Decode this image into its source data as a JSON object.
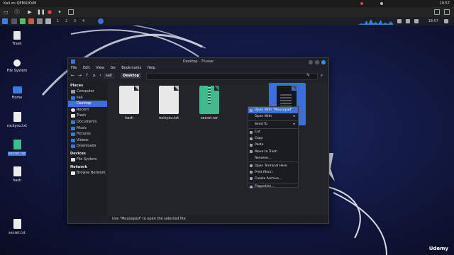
{
  "host": {
    "window_title": "Kali on QEMU/KVM",
    "clock": "19:57"
  },
  "panel": {
    "workspaces": [
      "1",
      "2",
      "3",
      "4"
    ],
    "clock": "18:57"
  },
  "desktop_icons": [
    {
      "label": "Trash",
      "icon": "trash-icon"
    },
    {
      "label": "File System",
      "icon": "drive-icon"
    },
    {
      "label": "Home",
      "icon": "home-folder-icon"
    },
    {
      "label": "rockyou.txt",
      "icon": "text-file-icon"
    },
    {
      "label": "secret.rar",
      "icon": "archive-file-icon"
    },
    {
      "label": "hash",
      "icon": "text-file-icon"
    },
    {
      "label": "secret.txt",
      "icon": "text-file-icon"
    }
  ],
  "window": {
    "title": "Desktop - Thunar",
    "menu": [
      "File",
      "Edit",
      "View",
      "Go",
      "Bookmarks",
      "Help"
    ],
    "breadcrumbs": [
      "kali",
      "Desktop"
    ]
  },
  "sidebar": {
    "places_label": "Places",
    "places": [
      "Computer",
      "kali",
      "Desktop",
      "Recent",
      "Trash",
      "Documents",
      "Music",
      "Pictures",
      "Videos",
      "Downloads"
    ],
    "devices_label": "Devices",
    "devices": [
      "File System"
    ],
    "network_label": "Network",
    "network": [
      "Browse Network"
    ]
  },
  "files": [
    {
      "name": "hash",
      "type": "text"
    },
    {
      "name": "rockyou.txt",
      "type": "text"
    },
    {
      "name": "secret.rar",
      "type": "archive"
    },
    {
      "name": "sec",
      "type": "text",
      "selected": true
    }
  ],
  "context_menu": [
    {
      "label": "Open With \"Mousepad\"",
      "highlighted": true
    },
    {
      "label": "Open With",
      "submenu": true
    },
    {
      "label": "Send To",
      "submenu": true
    },
    {
      "label": "Cut"
    },
    {
      "label": "Copy"
    },
    {
      "label": "Paste"
    },
    {
      "label": "Move to Trash"
    },
    {
      "label": "Rename..."
    },
    {
      "label": "Open Terminal Here"
    },
    {
      "label": "Print file(s)"
    },
    {
      "label": "Create Archive..."
    },
    {
      "label": "Properties..."
    }
  ],
  "status": "Use \"Mousepad\" to open the selected file",
  "watermark": "Udemy"
}
